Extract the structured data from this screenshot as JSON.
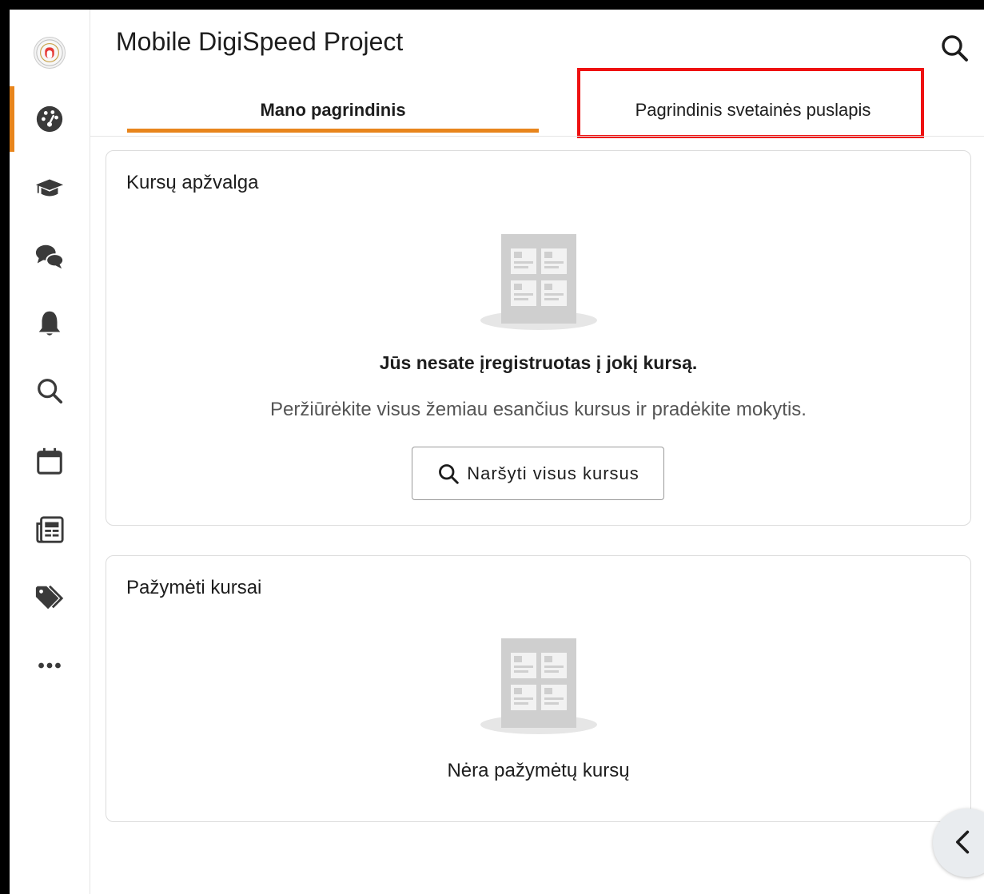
{
  "app": {
    "title": "Mobile DigiSpeed Project"
  },
  "tabs": [
    {
      "label": "Mano pagrindinis",
      "active": true
    },
    {
      "label": "Pagrindinis svetainės puslapis",
      "active": false
    }
  ],
  "sidebar": {
    "items": [
      {
        "icon": "dashboard-icon",
        "active": true
      },
      {
        "icon": "graduation-cap-icon",
        "active": false
      },
      {
        "icon": "messages-icon",
        "active": false
      },
      {
        "icon": "bell-icon",
        "active": false
      },
      {
        "icon": "search-icon",
        "active": false
      },
      {
        "icon": "calendar-icon",
        "active": false
      },
      {
        "icon": "newspaper-icon",
        "active": false
      },
      {
        "icon": "tags-icon",
        "active": false
      },
      {
        "icon": "more-icon",
        "active": false
      }
    ]
  },
  "course_overview": {
    "title": "Kursų apžvalga",
    "empty_title": "Jūs nesate įregistruotas į jokį kursą.",
    "empty_desc": "Peržiūrėkite visus žemiau esančius kursus ir pradėkite mokytis.",
    "browse_label": "Naršyti visus kursus"
  },
  "starred_courses": {
    "title": "Pažymėti kursai",
    "empty_desc": "Nėra pažymėtų kursų"
  },
  "colors": {
    "accent": "#e8851c",
    "highlight": "#ee1111",
    "text": "#1d1d1d",
    "icon": "#3a3a3a"
  }
}
